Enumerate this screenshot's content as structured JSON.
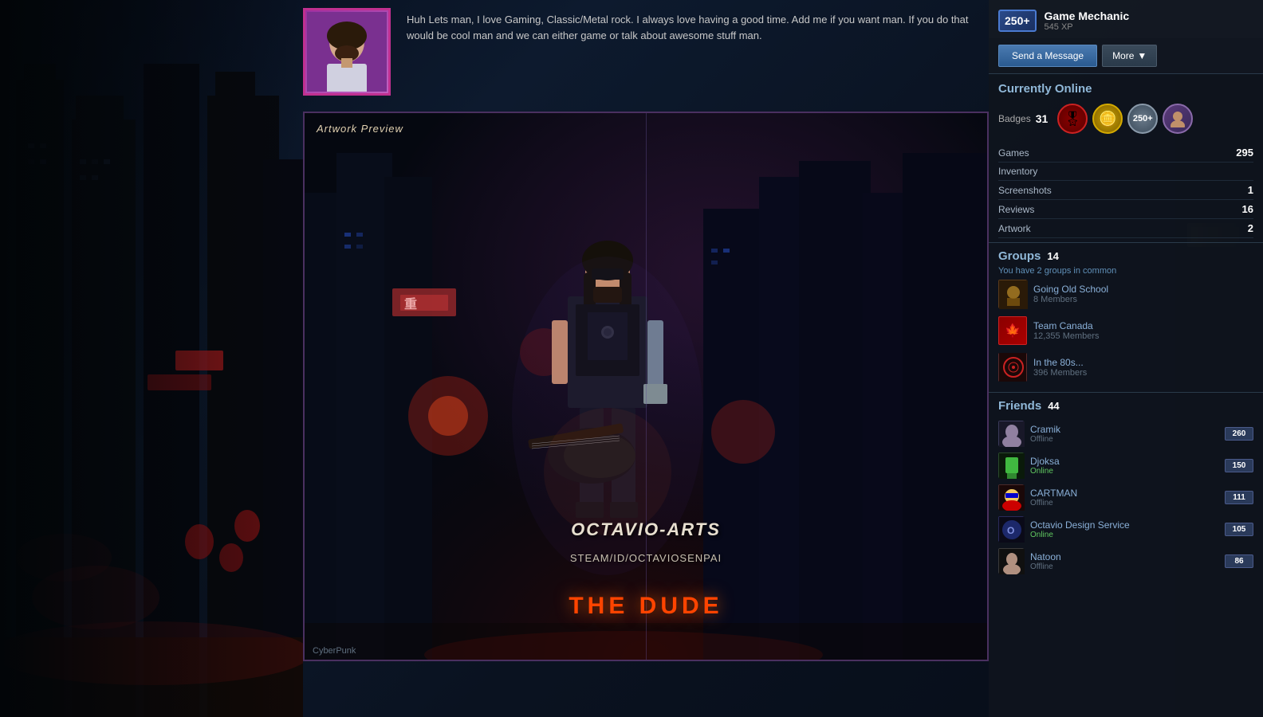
{
  "background": {
    "color": "#0a0e1a"
  },
  "profile": {
    "name": "Game Mechanic",
    "xp": "545 XP",
    "level": "250+",
    "bio": "Huh Lets man, I love Gaming, Classic/Metal rock. I always love having a good time. Add me if you want man. If you do that would be cool man and we can either game or talk about awesome stuff man.",
    "avatar_style": "purple-border"
  },
  "buttons": {
    "send_message": "Send a Message",
    "more": "More"
  },
  "status": {
    "label": "Currently Online"
  },
  "badges": {
    "label": "Badges",
    "count": "31",
    "items": [
      {
        "type": "red-ribbon",
        "symbol": "🎖"
      },
      {
        "type": "gold-coin",
        "symbol": "🪙"
      },
      {
        "type": "level-250",
        "text": "250+"
      },
      {
        "type": "avatar-badge",
        "symbol": "👤"
      }
    ]
  },
  "stats": {
    "games": {
      "label": "Games",
      "value": "295"
    },
    "inventory": {
      "label": "Inventory",
      "value": ""
    },
    "screenshots": {
      "label": "Screenshots",
      "value": "1"
    },
    "reviews": {
      "label": "Reviews",
      "value": "16"
    },
    "artwork": {
      "label": "Artwork",
      "value": "2"
    }
  },
  "groups": {
    "label": "Groups",
    "count": "14",
    "common_text": "You have",
    "common_count": "2",
    "common_suffix": "groups in common",
    "items": [
      {
        "name": "Going Old School",
        "members": "8 Members",
        "type": "old-school"
      },
      {
        "name": "Team Canada",
        "members": "12,355 Members",
        "type": "canada"
      },
      {
        "name": "In the 80s...",
        "members": "396 Members",
        "type": "80s"
      }
    ]
  },
  "friends": {
    "label": "Friends",
    "count": "44",
    "items": [
      {
        "name": "Cramik",
        "status": "Offline",
        "online": false,
        "level": "260"
      },
      {
        "name": "Djoksa",
        "status": "Online",
        "online": true,
        "level": "150"
      },
      {
        "name": "CARTMAN",
        "status": "Offline",
        "online": false,
        "level": "111"
      },
      {
        "name": "Octavio Design Service",
        "status": "Online",
        "online": true,
        "level": "105"
      },
      {
        "name": "Natoon",
        "status": "Offline",
        "online": false,
        "level": "86"
      }
    ]
  },
  "artwork": {
    "preview_label": "Artwork Preview",
    "artist_name": "OCTAVIO-ARTS",
    "steam_url": "STEAM/ID/OCTAVIOSENPAI",
    "title": "THE DUDE",
    "game": "CyberPunk"
  }
}
